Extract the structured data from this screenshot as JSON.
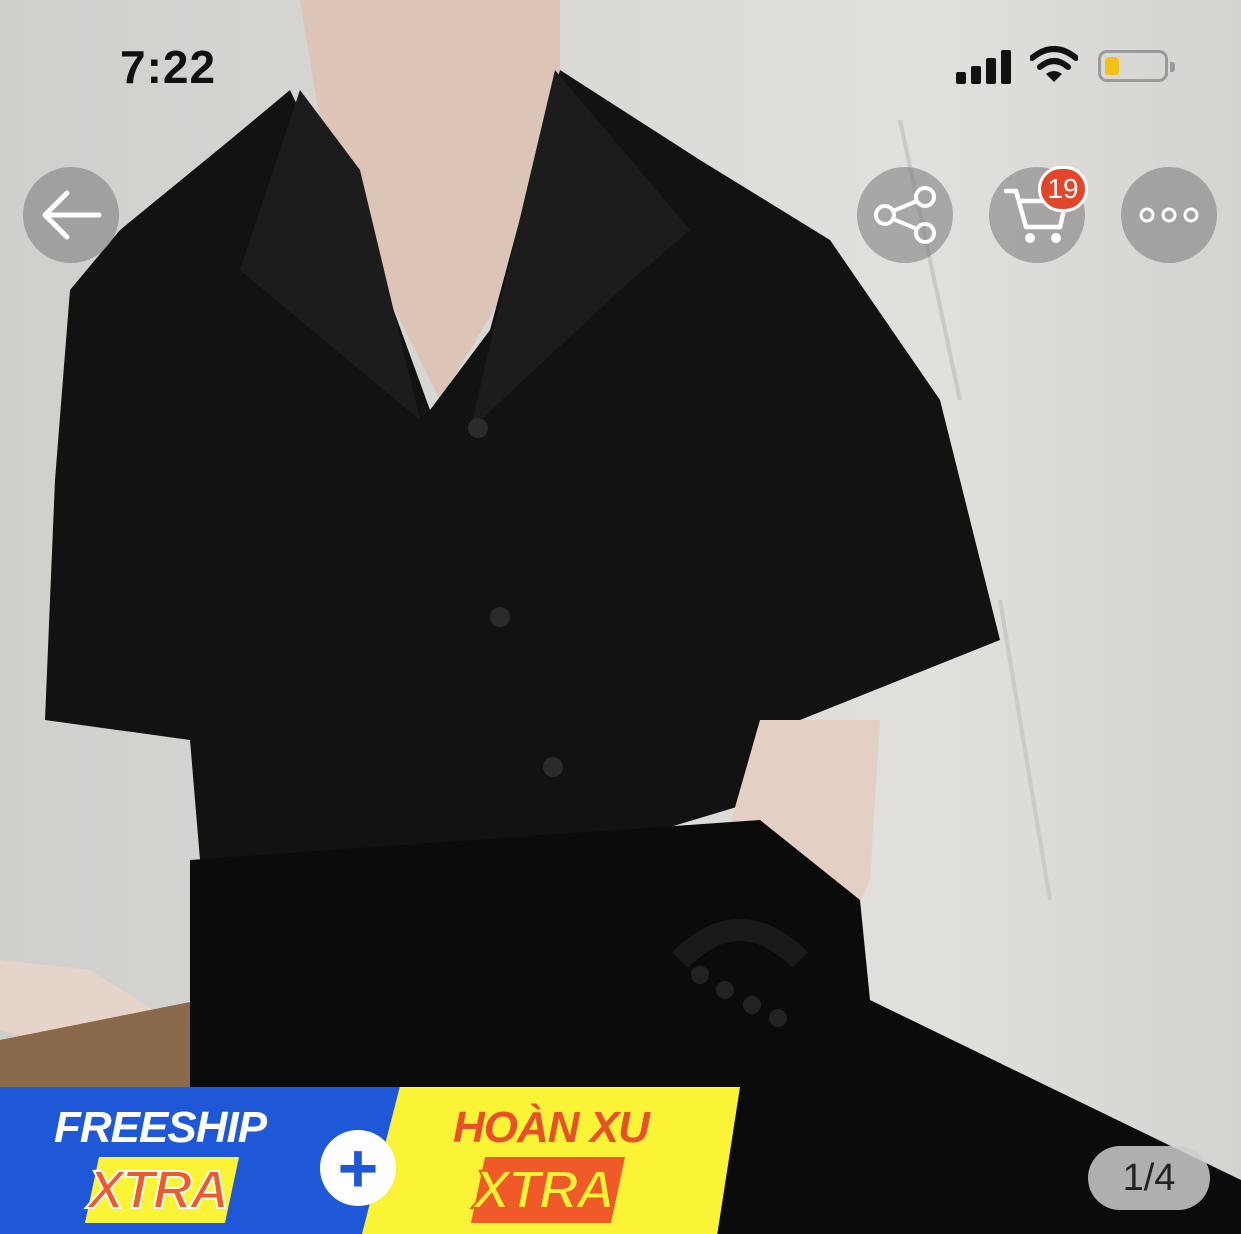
{
  "status_bar": {
    "time": "7:22"
  },
  "nav": {
    "back_icon": "arrow-left-icon",
    "share_icon": "share-icon",
    "cart_icon": "cart-icon",
    "cart_count": "19",
    "more_icon": "more-dots-icon"
  },
  "promo": {
    "left_title": "FREESHIP",
    "left_tag": "XTRA",
    "plus": "+",
    "right_title": "HOÀN XU",
    "right_tag": "XTRA"
  },
  "gallery": {
    "page_indicator": "1/4"
  },
  "colors": {
    "promo_blue": "#1f58d6",
    "promo_yellow": "#fbf335",
    "xtra_orange": "#f05a28",
    "badge_red": "#e2452c"
  }
}
